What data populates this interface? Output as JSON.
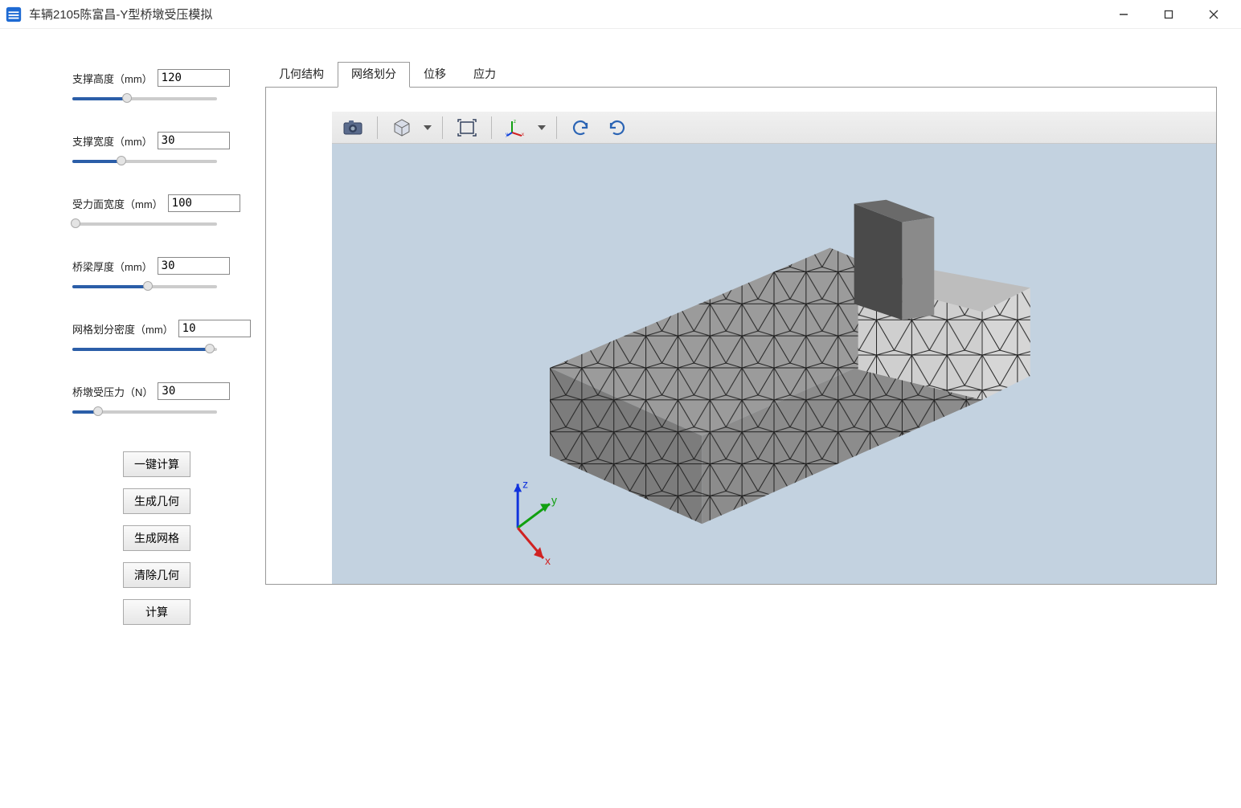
{
  "window": {
    "title": "车辆2105陈富昌-Y型桥墩受压模拟"
  },
  "params": [
    {
      "label": "支撑高度（mm）",
      "value": "120",
      "fillPct": 38
    },
    {
      "label": "支撑宽度（mm）",
      "value": "30",
      "fillPct": 34
    },
    {
      "label": "受力面宽度（mm）",
      "value": "100",
      "fillPct": 2
    },
    {
      "label": "桥梁厚度（mm）",
      "value": "30",
      "fillPct": 52
    },
    {
      "label": "网格划分密度（mm）",
      "value": "10",
      "fillPct": 95
    },
    {
      "label": "桥墩受压力（N）",
      "value": "30",
      "fillPct": 18
    }
  ],
  "buttons": {
    "oneKey": "一键计算",
    "genGeom": "生成几何",
    "genMesh": "生成网格",
    "clearGeom": "清除几何",
    "compute": "计算"
  },
  "tabs": [
    {
      "id": "geom",
      "label": "几何结构",
      "active": false
    },
    {
      "id": "mesh",
      "label": "网络划分",
      "active": true
    },
    {
      "id": "disp",
      "label": "位移",
      "active": false
    },
    {
      "id": "stress",
      "label": "应力",
      "active": false
    }
  ],
  "viewerToolbar": {
    "camera": "camera-icon",
    "cube": "cube-icon",
    "fit": "fit-screen-icon",
    "axes": "axes-icon",
    "rotLeft": "rotate-left-icon",
    "rotRight": "rotate-right-icon"
  },
  "axisTriad": {
    "x": "x",
    "y": "y",
    "z": "z"
  }
}
